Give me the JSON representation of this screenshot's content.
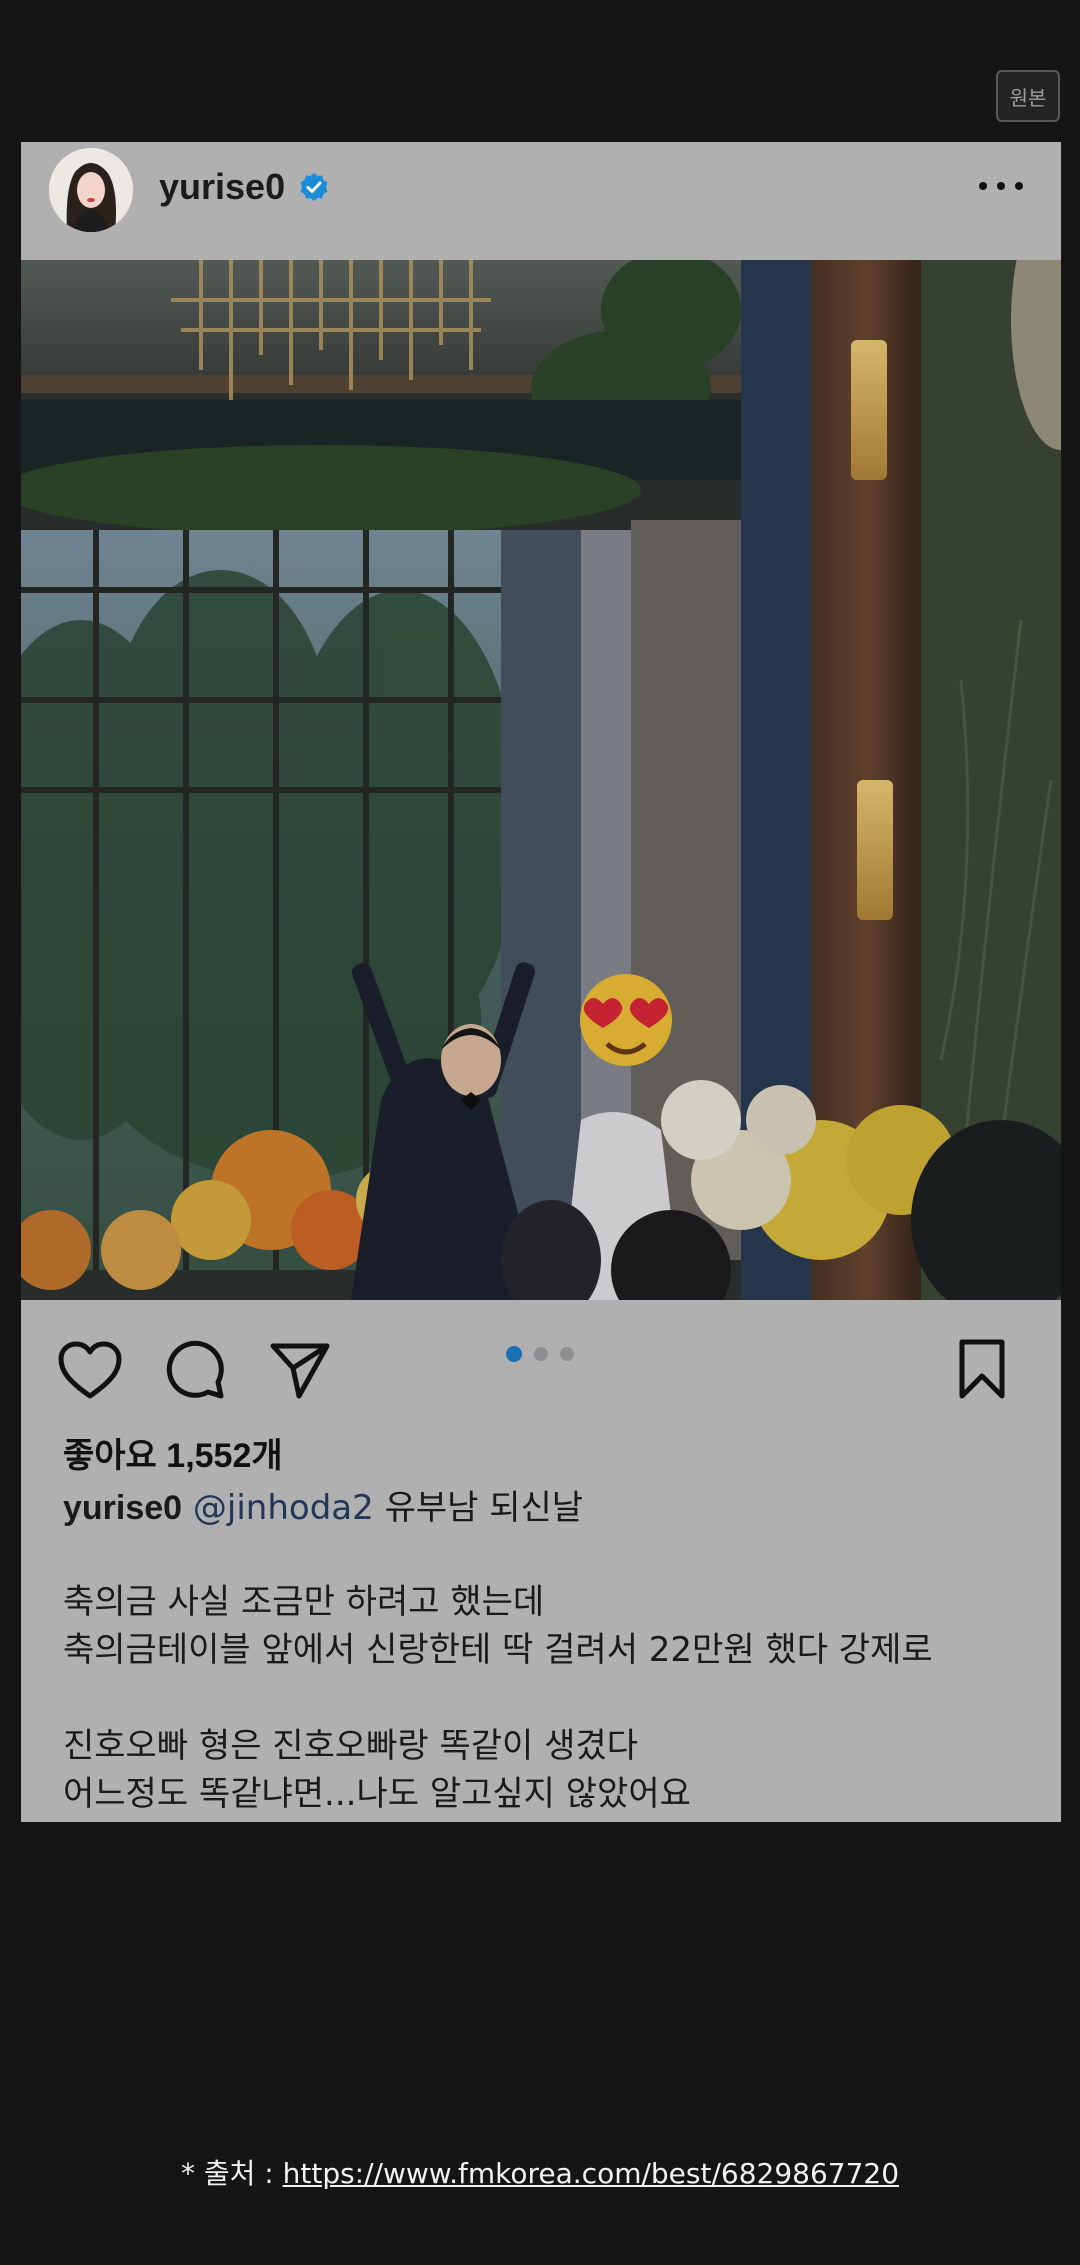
{
  "top": {
    "original_label": "원본"
  },
  "post": {
    "username": "yurise0",
    "likes_text": "좋아요 1,552개",
    "caption_user": "yurise0",
    "caption_mention": "@jinhoda2",
    "caption_text": "유부남 되신날",
    "body_lines": [
      "축의금 사실 조금만 하려고 했는데",
      "축의금테이블 앞에서 신랑한테 딱 걸려서 22만원 했다 강제로",
      "진호오빠 형은 진호오빠랑 똑같이 생겼다",
      "어느정도 똑같냐면...나도 알고싶지 않았어요"
    ],
    "carousel": {
      "count": 3,
      "active": 1
    },
    "colors": {
      "verified": "#1a8cd8",
      "dot_active": "#1a6fb5",
      "card_bg": "#b0b0b1"
    },
    "icons": [
      "heart-icon",
      "comment-icon",
      "share-icon",
      "bookmark-icon",
      "more-icon",
      "verified-icon"
    ]
  },
  "footer": {
    "source_prefix": "* 출처 : ",
    "source_link": "https://www.fmkorea.com/best/6829867720"
  }
}
